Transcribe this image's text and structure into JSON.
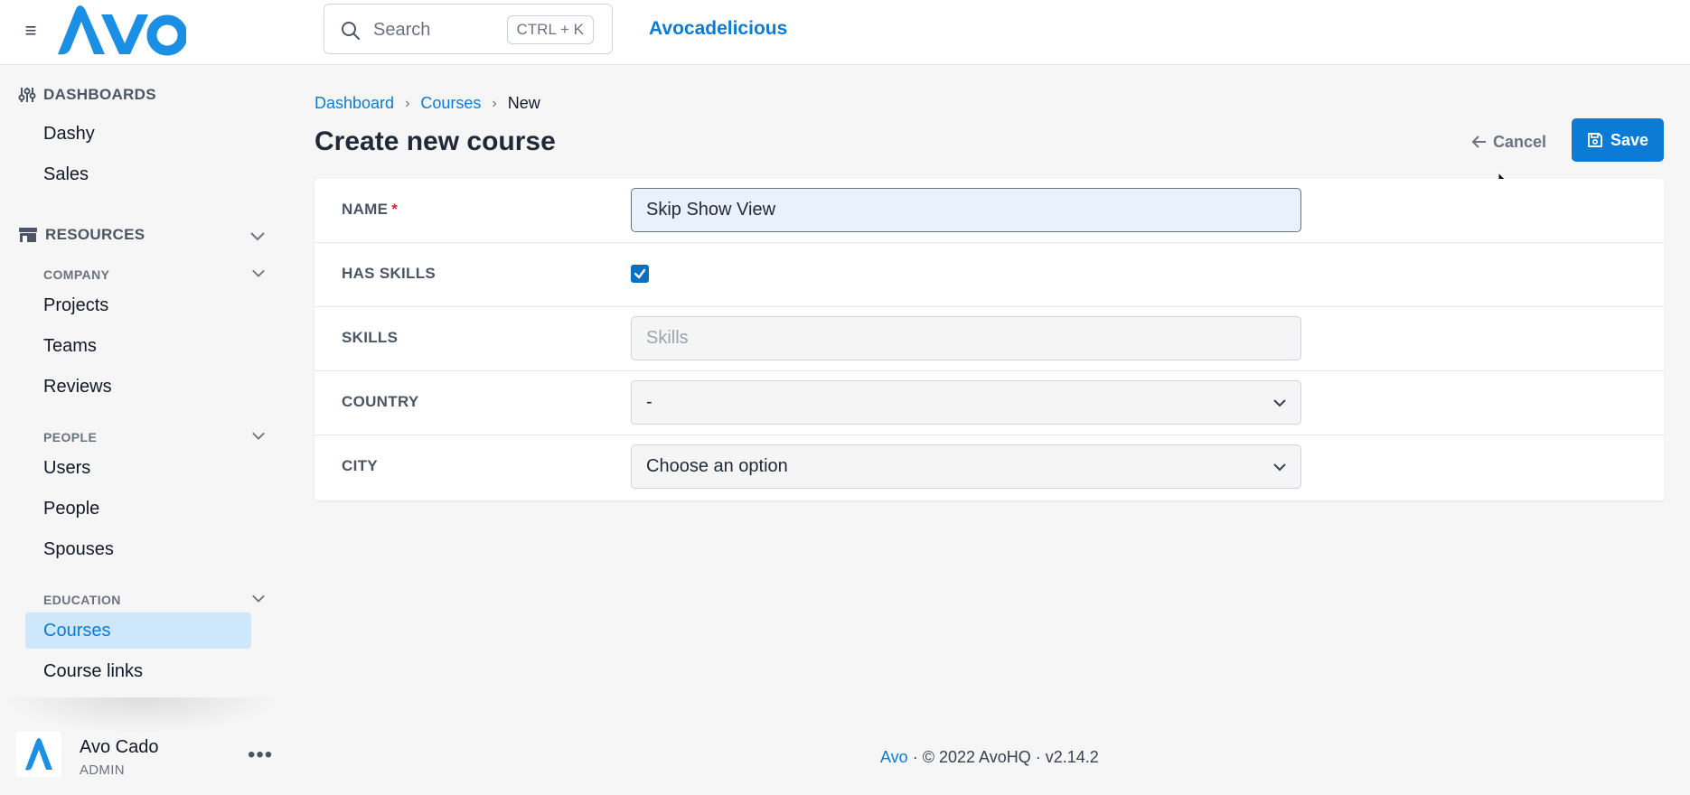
{
  "header": {
    "logo_text": "Avo",
    "search_placeholder": "Search",
    "search_shortcut": "CTRL + K",
    "app_name": "Avocadelicious"
  },
  "sidebar": {
    "dashboards_label": "DASHBOARDS",
    "dashboards": [
      "Dashy",
      "Sales"
    ],
    "resources_label": "RESOURCES",
    "groups": [
      {
        "label": "COMPANY",
        "items": [
          "Projects",
          "Teams",
          "Reviews"
        ]
      },
      {
        "label": "PEOPLE",
        "items": [
          "Users",
          "People",
          "Spouses"
        ]
      },
      {
        "label": "EDUCATION",
        "items": [
          "Courses",
          "Course links"
        ]
      }
    ],
    "active_item": "Courses",
    "user": {
      "name": "Avo Cado",
      "role": "ADMIN"
    }
  },
  "breadcrumb": {
    "items": [
      "Dashboard",
      "Courses"
    ],
    "current": "New"
  },
  "page": {
    "title": "Create new course",
    "cancel_label": "Cancel",
    "save_label": "Save"
  },
  "form": {
    "name": {
      "label": "NAME",
      "required_mark": "*",
      "value": "Skip Show View"
    },
    "has_skills": {
      "label": "HAS SKILLS",
      "checked": true
    },
    "skills": {
      "label": "SKILLS",
      "placeholder": "Skills"
    },
    "country": {
      "label": "COUNTRY",
      "value": "-"
    },
    "city": {
      "label": "CITY",
      "value": "Choose an option"
    }
  },
  "footer": {
    "link": "Avo",
    "text": " · © 2022 AvoHQ · v2.14.2"
  },
  "colors": {
    "accent": "#0b7bd5",
    "active_bg": "#cfe7fb",
    "page_bg": "#f6f6f6"
  },
  "icons": [
    "hamburger-icon",
    "avo-logo",
    "search-icon",
    "dashboards-icon",
    "resources-icon",
    "chevron-down-icon",
    "arrow-left-icon",
    "save-icon",
    "check-icon",
    "more-dots-icon",
    "mouse-cursor-icon"
  ]
}
